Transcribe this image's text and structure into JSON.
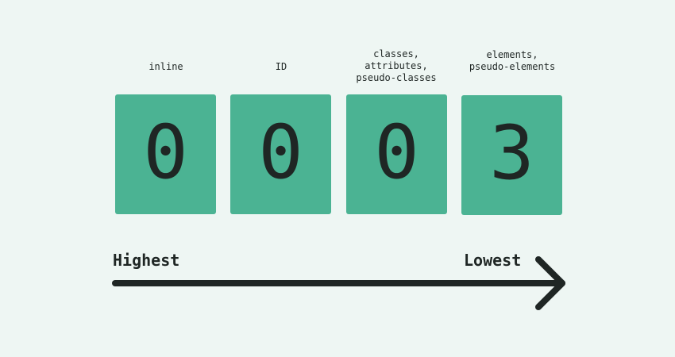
{
  "columns": [
    {
      "label": "inline",
      "value": "0"
    },
    {
      "label": "ID",
      "value": "0"
    },
    {
      "label": "classes,\nattributes,\npseudo-classes",
      "value": "0"
    },
    {
      "label": "elements,\npseudo-elements",
      "value": "3"
    }
  ],
  "scale": {
    "high_label": "Highest",
    "low_label": "Lowest"
  },
  "colors": {
    "background": "#eef6f3",
    "box": "#4bb393",
    "ink": "#1f2624"
  }
}
